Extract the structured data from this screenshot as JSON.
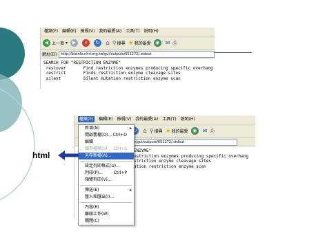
{
  "menus": [
    "檔案(F)",
    "編輯(E)",
    "檢視(V)",
    "我的最愛(A)",
    "工具(T)",
    "說明(H)"
  ],
  "toolbar": {
    "back": "上一頁",
    "search": "搜尋",
    "favorites": "我的最愛"
  },
  "address": {
    "label": "網址(D)",
    "url": "http://bioinfo.nhri.org.tw/gui/outputs/651272/.stdout"
  },
  "address2": {
    "url": "tw/gui/outputs/651272/.stdout"
  },
  "content_lines": [
    "SEARCH FOR \"RESTRICTION ENZYME\"",
    " restover       Find restriction enzymes producing specific overhang",
    " restrict       Finds restriction enzyme cleavage sites",
    " silent         Silent mutation restriction enzyme scan"
  ],
  "content_lines2": [
    "ENZYME\"",
    "estriction enzymes producing specific overhang",
    "striction enzyme cleavage sites",
    "ation restriction enzyme scan"
  ],
  "file_menu": [
    {
      "label": "新增(N)",
      "arrow": "▸"
    },
    {
      "label": "開啟舊檔(O)...",
      "shortcut": "Ctrl+O"
    },
    {
      "label": "編輯"
    },
    {
      "label": "儲存檔案(S)",
      "shortcut": "Ctrl+S",
      "disabled": true
    },
    {
      "label": "另存新檔(A)...",
      "highlight": true
    },
    {
      "sep": true
    },
    {
      "label": "設定列印格式(U)..."
    },
    {
      "label": "列印(P)...",
      "shortcut": "Ctrl+P"
    },
    {
      "label": "預覽列印(V)..."
    },
    {
      "sep": true
    },
    {
      "label": "傳送(E)",
      "arrow": "▸"
    },
    {
      "label": "匯入和匯出(I)..."
    },
    {
      "sep": true
    },
    {
      "label": "內容(R)"
    },
    {
      "label": "離線工作(W)"
    },
    {
      "label": "關閉(C)"
    }
  ],
  "annotation": "html",
  "colors": {
    "accent": "#316ac5",
    "teal": "#2a7a80",
    "arrow": "#1f3a9c"
  }
}
